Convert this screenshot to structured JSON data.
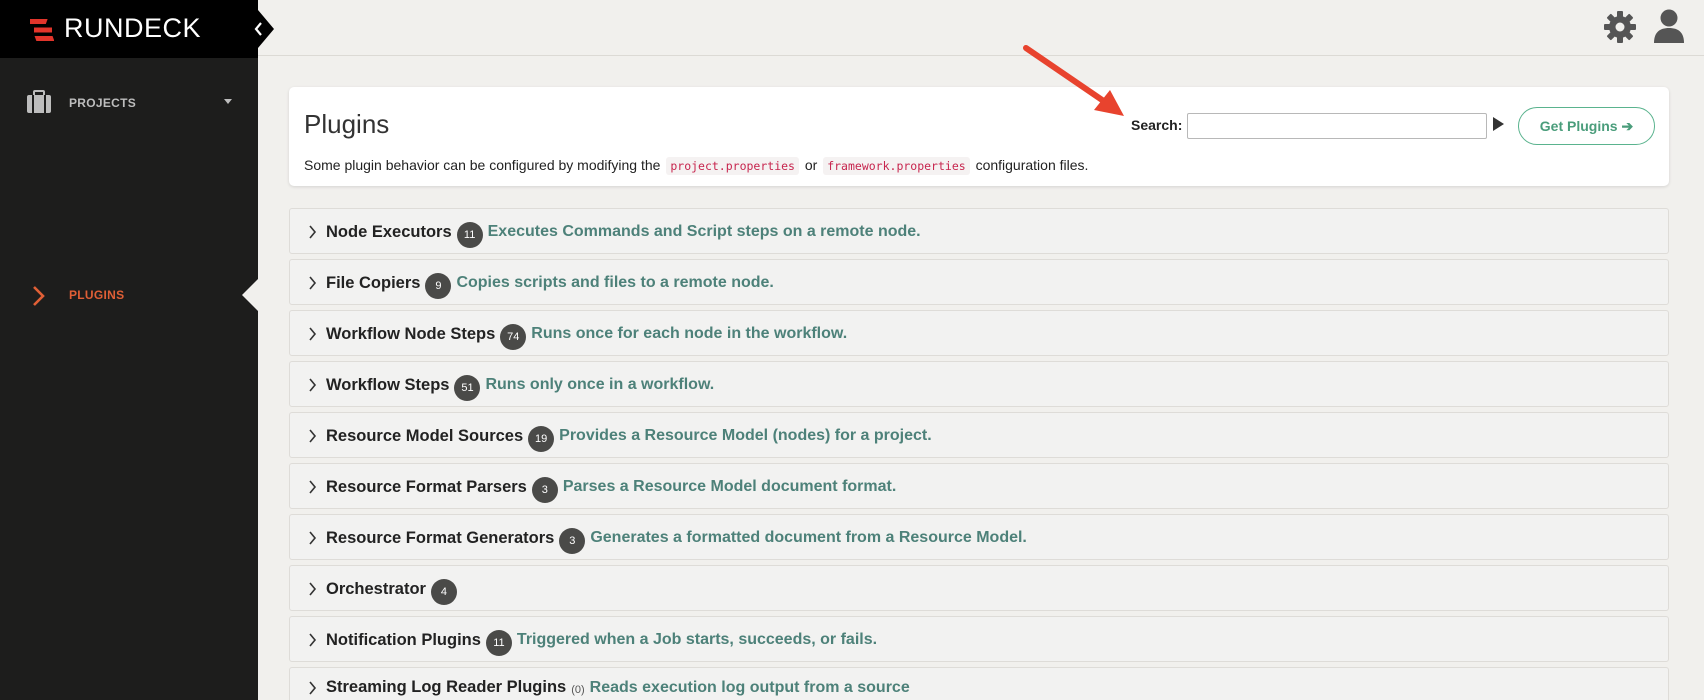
{
  "app": {
    "brand": "RUNDECK"
  },
  "sidebar": {
    "items": [
      {
        "label": "PROJECTS",
        "icon": "briefcase-icon"
      },
      {
        "label": "PLUGINS",
        "icon": "chevron-right-icon"
      }
    ]
  },
  "header": {
    "title": "Plugins",
    "desc_prefix": "Some plugin behavior can be configured by modifying the",
    "code1": "project.properties",
    "desc_or": "or",
    "code2": "framework.properties",
    "desc_suffix": "configuration files.",
    "search_label": "Search:",
    "search_value": "",
    "get_plugins_label": "Get Plugins ➔"
  },
  "plugin_groups": [
    {
      "title": "Node Executors",
      "count": "11",
      "desc": "Executes Commands and Script steps on a remote node."
    },
    {
      "title": "File Copiers",
      "count": "9",
      "desc": "Copies scripts and files to a remote node."
    },
    {
      "title": "Workflow Node Steps",
      "count": "74",
      "desc": "Runs once for each node in the workflow."
    },
    {
      "title": "Workflow Steps",
      "count": "51",
      "desc": "Runs only once in a workflow."
    },
    {
      "title": "Resource Model Sources",
      "count": "19",
      "desc": "Provides a Resource Model (nodes) for a project."
    },
    {
      "title": "Resource Format Parsers",
      "count": "3",
      "desc": "Parses a Resource Model document format."
    },
    {
      "title": "Resource Format Generators",
      "count": "3",
      "desc": "Generates a formatted document from a Resource Model."
    },
    {
      "title": "Orchestrator",
      "count": "4",
      "desc": ""
    },
    {
      "title": "Notification Plugins",
      "count": "11",
      "desc": "Triggered when a Job starts, succeeds, or fails."
    },
    {
      "title": "Streaming Log Reader Plugins",
      "count": "(0)",
      "desc": "Reads execution log output from a source"
    }
  ],
  "colors": {
    "brand_accent": "#e05f36",
    "logo_red": "#e1352b",
    "link_teal": "#4d8179",
    "button_green": "#5ab38e",
    "annotation_red": "#e8432e"
  }
}
